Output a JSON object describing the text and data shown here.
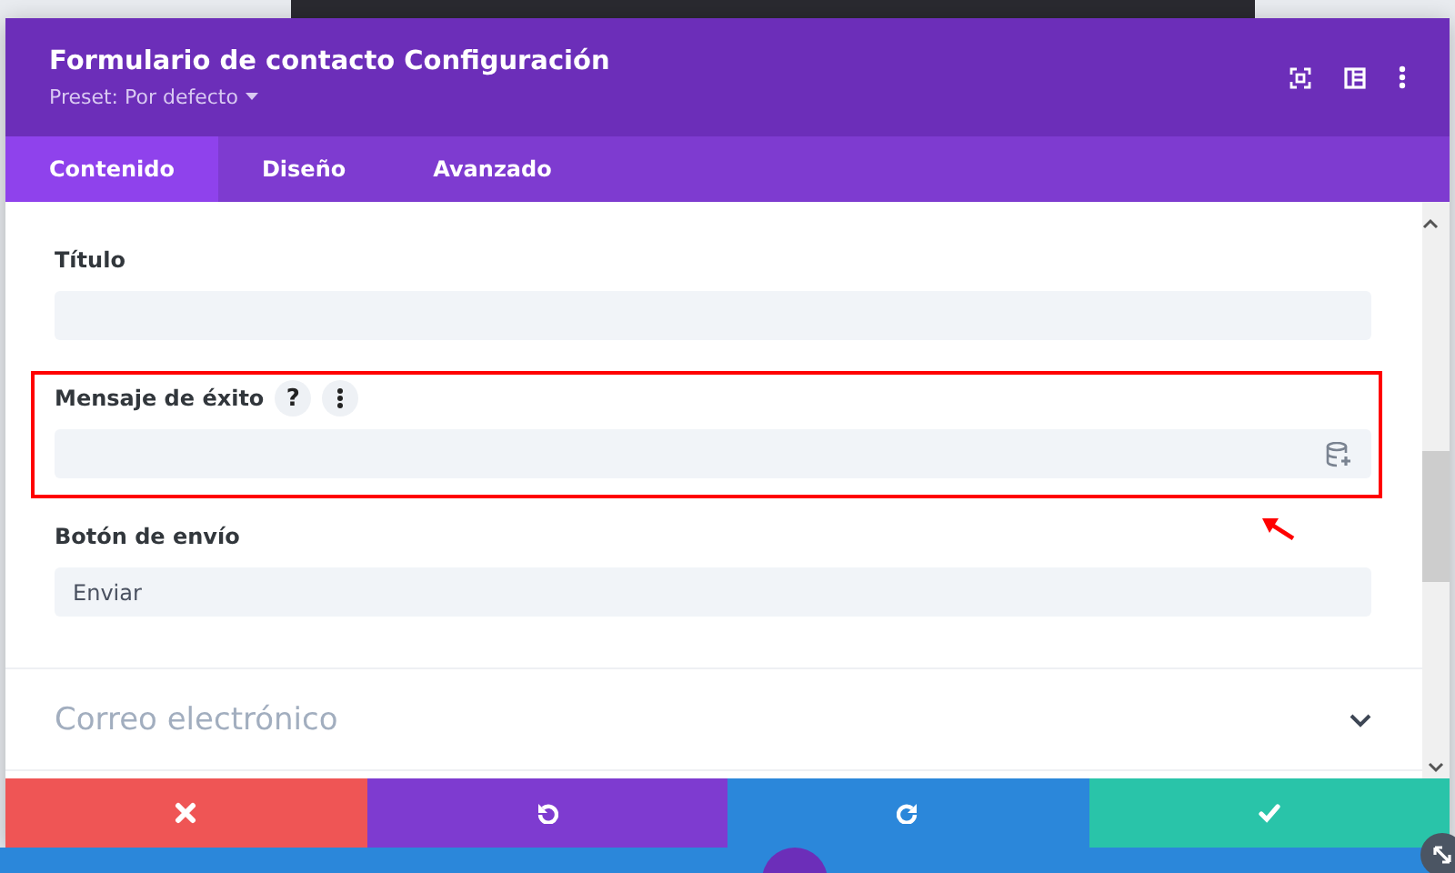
{
  "window": {
    "title": "Formulario de contacto Configuración",
    "preset": "Preset: Por defecto"
  },
  "tabs": [
    {
      "label": "Contenido",
      "selected": true
    },
    {
      "label": "Diseño",
      "selected": false
    },
    {
      "label": "Avanzado",
      "selected": false
    }
  ],
  "fields": [
    {
      "label": "Título",
      "highlighted": false,
      "dynamic_content": false
    },
    {
      "label": "Mensaje de éxito",
      "help": "?",
      "highlighted": true,
      "dynamic_content": true
    },
    {
      "label": "Botón de envío",
      "value": "Enviar",
      "highlighted": false,
      "dynamic_content": false
    }
  ],
  "sections": [
    {
      "title": "Correo electrónico",
      "expanded": false
    }
  ],
  "footer_buttons": [
    {
      "kind": "cancel"
    },
    {
      "kind": "undo"
    },
    {
      "kind": "redo"
    },
    {
      "kind": "save"
    }
  ]
}
